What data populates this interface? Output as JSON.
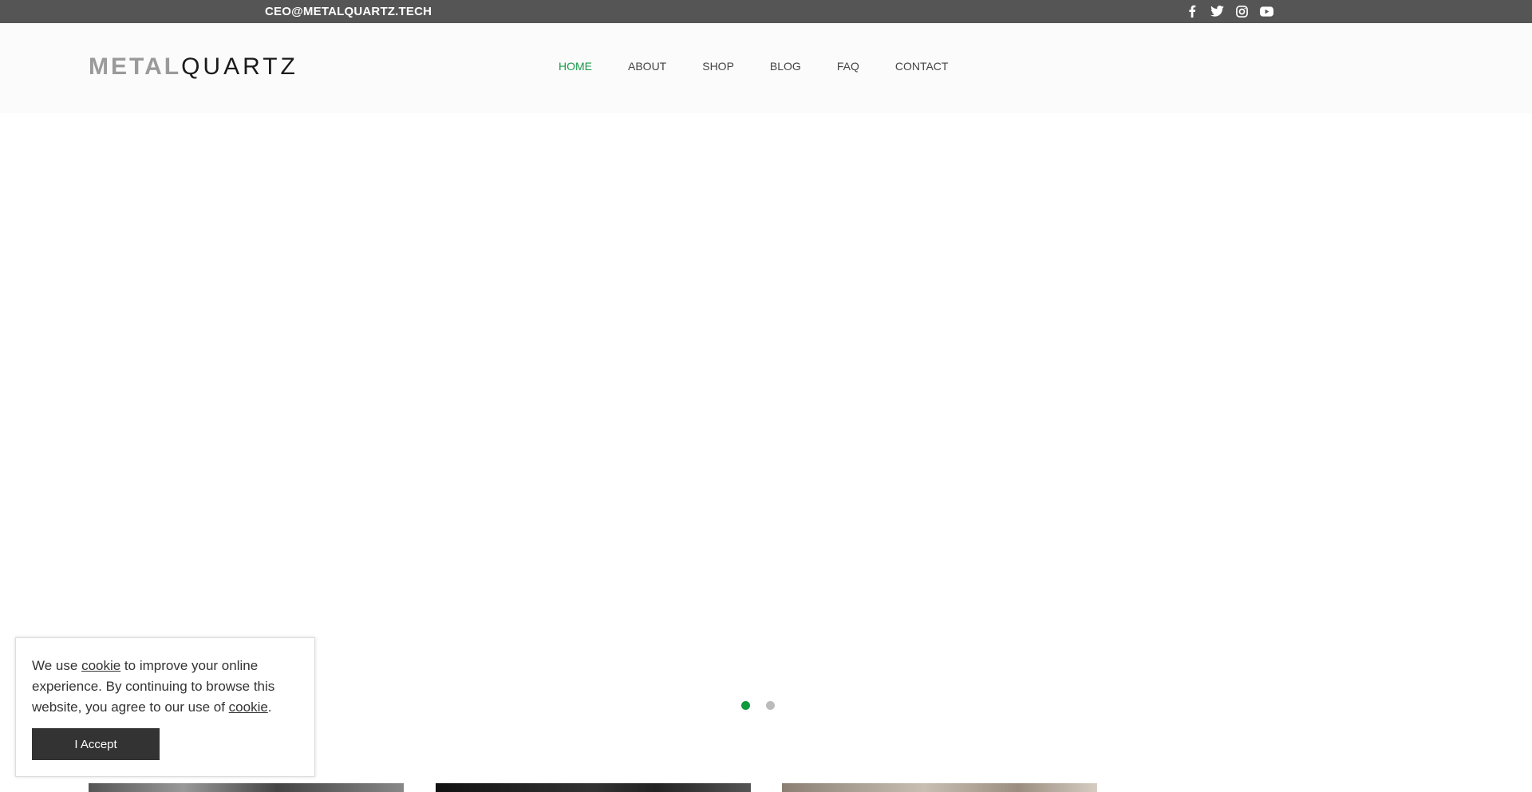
{
  "topbar": {
    "email": "CEO@METALQUARTZ.TECH",
    "socials": [
      "facebook-icon",
      "twitter-icon",
      "instagram-icon",
      "youtube-icon"
    ]
  },
  "header": {
    "logo_part1": "METAL",
    "logo_part2": "QUARTZ"
  },
  "nav": {
    "items": [
      {
        "label": "HOME",
        "active": true
      },
      {
        "label": "ABOUT",
        "active": false
      },
      {
        "label": "SHOP",
        "active": false
      },
      {
        "label": "BLOG",
        "active": false
      },
      {
        "label": "FAQ",
        "active": false
      },
      {
        "label": "CONTACT",
        "active": false
      }
    ]
  },
  "slider": {
    "slide_count": 2,
    "active_index": 0
  },
  "cookie": {
    "text_before": "We use ",
    "link1": "cookie",
    "text_middle": " to improve your online experience. By continuing to browse this website, you agree to our use of ",
    "link2": "cookie",
    "text_after": ".",
    "button": "I Accept"
  },
  "colors": {
    "accent": "#1a9a4a",
    "topbar": "#555555",
    "button": "#333333"
  }
}
